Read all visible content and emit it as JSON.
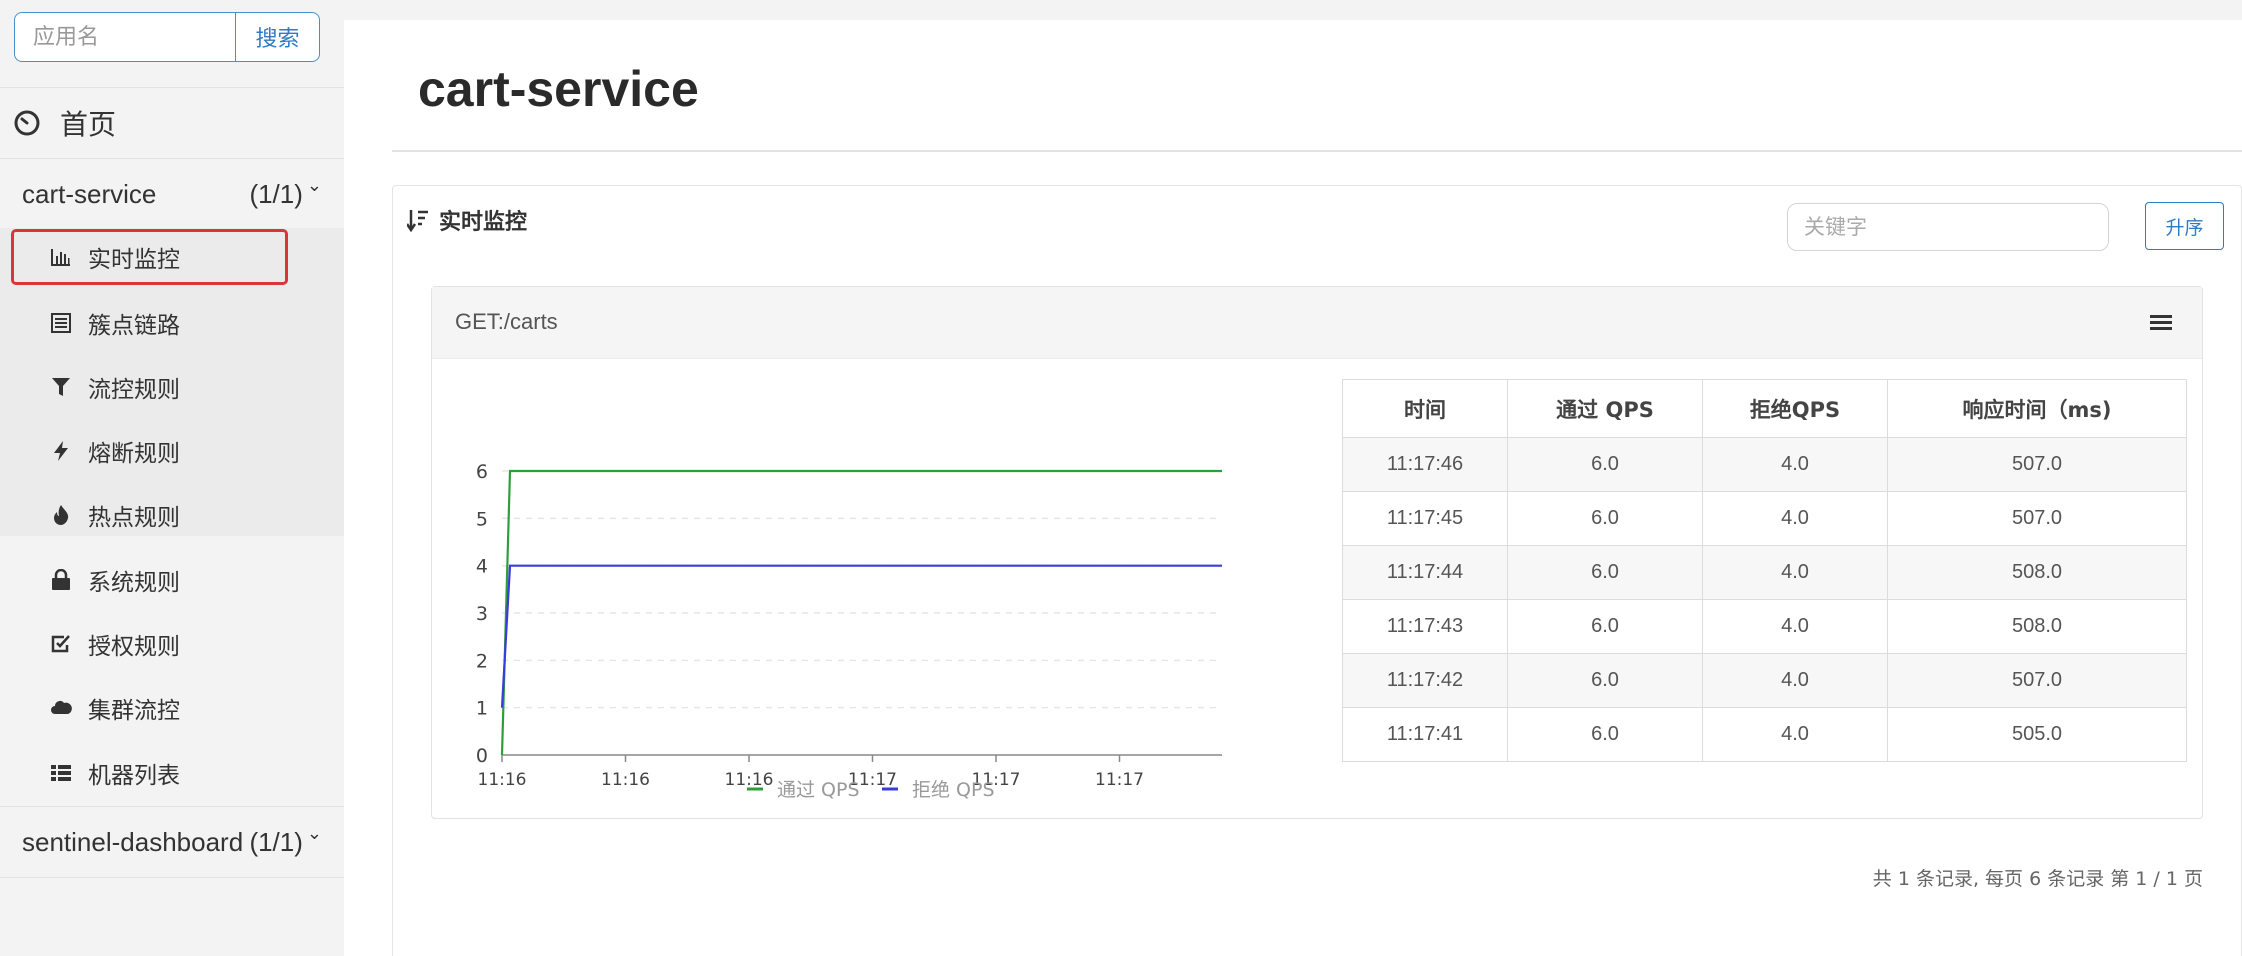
{
  "sidebar": {
    "search_placeholder": "应用名",
    "search_button": "搜索",
    "home_label": "首页",
    "apps": [
      {
        "name": "cart-service",
        "count": "(1/1)",
        "expanded": true,
        "items": [
          {
            "label": "实时监控",
            "icon": "bar-chart-icon",
            "active": true
          },
          {
            "label": "簇点链路",
            "icon": "list-alt-icon",
            "active": false
          },
          {
            "label": "流控规则",
            "icon": "filter-icon",
            "active": false
          },
          {
            "label": "熔断规则",
            "icon": "flash-icon",
            "active": false
          },
          {
            "label": "热点规则",
            "icon": "fire-icon",
            "active": false
          },
          {
            "label": "系统规则",
            "icon": "lock-icon",
            "active": false
          },
          {
            "label": "授权规则",
            "icon": "check-icon",
            "active": false
          },
          {
            "label": "集群流控",
            "icon": "cloud-icon",
            "active": false
          },
          {
            "label": "机器列表",
            "icon": "th-list-icon",
            "active": false
          }
        ]
      },
      {
        "name": "sentinel-dashboard",
        "count": "(1/1)",
        "expanded": false
      }
    ]
  },
  "main": {
    "title": "cart-service",
    "panel_title": "实时监控",
    "keyword_placeholder": "关键字",
    "sort_button": "升序",
    "resource": {
      "name": "GET:/carts",
      "table": {
        "headers": [
          "时间",
          "通过 QPS",
          "拒绝QPS",
          "响应时间（ms)"
        ],
        "rows": [
          [
            "11:17:46",
            "6.0",
            "4.0",
            "507.0"
          ],
          [
            "11:17:45",
            "6.0",
            "4.0",
            "507.0"
          ],
          [
            "11:17:44",
            "6.0",
            "4.0",
            "508.0"
          ],
          [
            "11:17:43",
            "6.0",
            "4.0",
            "508.0"
          ],
          [
            "11:17:42",
            "6.0",
            "4.0",
            "507.0"
          ],
          [
            "11:17:41",
            "6.0",
            "4.0",
            "505.0"
          ]
        ]
      }
    },
    "pager_text": "共 1 条记录, 每页 6 条记录 第 1 / 1 页"
  },
  "chart_data": {
    "type": "line",
    "x_ticks": [
      "11:16",
      "11:16",
      "11:16",
      "11:17",
      "11:17",
      "11:17"
    ],
    "ylim": [
      0,
      6
    ],
    "y_ticks": [
      0,
      1,
      2,
      3,
      4,
      5,
      6
    ],
    "grid": true,
    "legend_position": "bottom",
    "series": [
      {
        "name": "通过 QPS",
        "color": "#2e9e3a",
        "values": [
          0,
          6,
          6,
          6,
          6,
          6,
          6,
          6
        ]
      },
      {
        "name": "拒绝 QPS",
        "color": "#3b3bdc",
        "values": [
          1,
          4,
          4,
          4,
          4,
          4,
          4,
          4
        ]
      }
    ]
  },
  "colors": {
    "accent": "#2f7bc4",
    "active_border": "#d9353b"
  }
}
